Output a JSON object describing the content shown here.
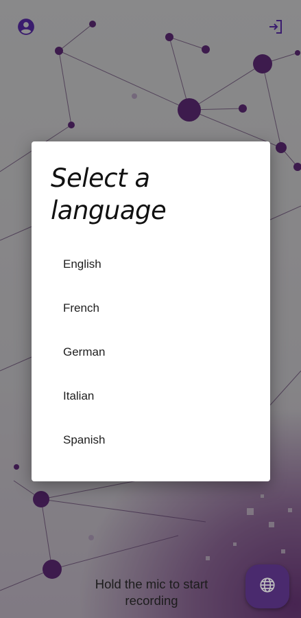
{
  "header": {
    "account_icon": "account-circle-icon",
    "logout_icon": "logout-icon",
    "icon_color": "#3a1c6e"
  },
  "dialog": {
    "title": "Select a language",
    "options": [
      "English",
      "French",
      "German",
      "Italian",
      "Spanish"
    ]
  },
  "footer": {
    "hint": "Hold the mic to start recording",
    "fab_icon": "globe-icon",
    "fab_color": "#4a2a6e"
  }
}
